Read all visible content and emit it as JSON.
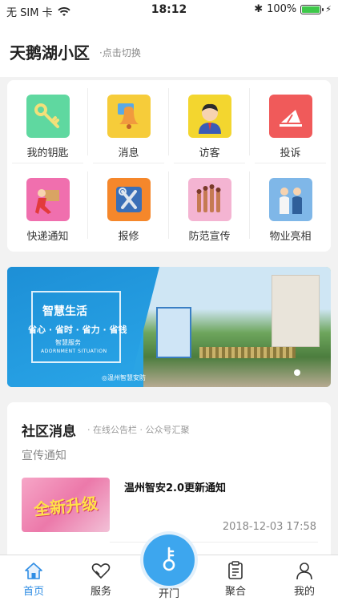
{
  "status_bar": {
    "carrier": "无 SIM 卡",
    "time": "18:12",
    "battery": "100%"
  },
  "header": {
    "title": "天鹅湖小区",
    "switch_hint": "·点击切换"
  },
  "menu": {
    "items": [
      {
        "label": "我的钥匙",
        "icon": "key-icon",
        "color": "#5fd8a0"
      },
      {
        "label": "消息",
        "icon": "bell-icon",
        "color": "#f6cc3a"
      },
      {
        "label": "访客",
        "icon": "visitor-icon",
        "color": "#f3d62f"
      },
      {
        "label": "投诉",
        "icon": "complaint-icon",
        "color": "#f05a5a"
      },
      {
        "label": "快递通知",
        "icon": "delivery-icon",
        "color": "#f06fae"
      },
      {
        "label": "报修",
        "icon": "repair-icon",
        "color": "#f5872b"
      },
      {
        "label": "防范宣传",
        "icon": "prevention-icon",
        "color": "#f4b4d2"
      },
      {
        "label": "物业亮相",
        "icon": "staff-icon",
        "color": "#7fb7e8"
      }
    ]
  },
  "banner": {
    "title": "智慧生活",
    "subtitle": "省心 · 省时 · 省力 · 省钱",
    "small": "智慧服务",
    "english": "ADORNMENT SITUATION",
    "brand": "◎温州智慧安防"
  },
  "news": {
    "heading": "社区消息",
    "subheading": "· 在线公告栏 · 公众号汇聚",
    "category": "宣传通知",
    "item": {
      "title": "温州智安2.0更新通知",
      "time": "2018-12-03 17:58",
      "thumb_text": "全新升级"
    }
  },
  "tabbar": {
    "tabs": [
      {
        "label": "首页",
        "icon": "home-icon",
        "active": true
      },
      {
        "label": "服务",
        "icon": "service-icon",
        "active": false
      },
      {
        "label": "开门",
        "icon": "open-door-icon",
        "active": false
      },
      {
        "label": "聚合",
        "icon": "aggregate-icon",
        "active": false
      },
      {
        "label": "我的",
        "icon": "profile-icon",
        "active": false
      }
    ]
  },
  "colors": {
    "accent": "#2f8de4",
    "open_button": "#3da6ee"
  }
}
